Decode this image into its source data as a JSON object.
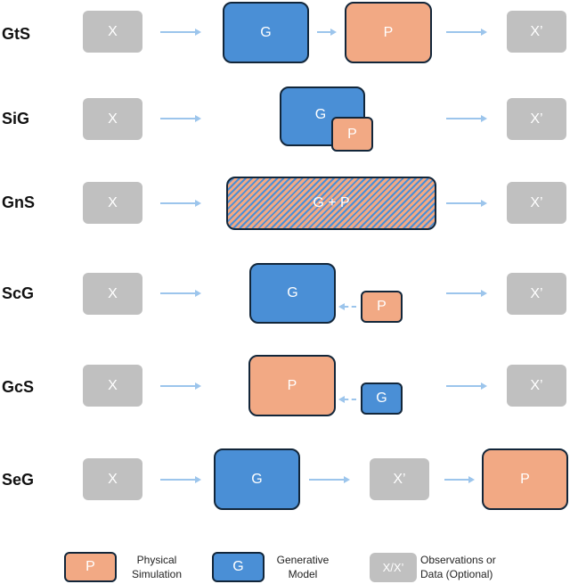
{
  "rows": [
    {
      "label": "GtS",
      "input": "X",
      "output": "X’",
      "g": "G",
      "p": "P"
    },
    {
      "label": "SiG",
      "input": "X",
      "output": "X’",
      "g": "G",
      "p": "P"
    },
    {
      "label": "GnS",
      "input": "X",
      "output": "X’",
      "combined": "G + P"
    },
    {
      "label": "ScG",
      "input": "X",
      "output": "X’",
      "g": "G",
      "p": "P"
    },
    {
      "label": "GcS",
      "input": "X",
      "output": "X’",
      "g": "G",
      "p": "P"
    },
    {
      "label": "SeG",
      "input": "X",
      "intermediate": "X’",
      "g": "G",
      "p": "P"
    }
  ],
  "legend": {
    "physical": {
      "symbol": "P",
      "line1": "Physical",
      "line2": "Simulation"
    },
    "generative": {
      "symbol": "G",
      "line1": "Generative",
      "line2": "Model"
    },
    "data": {
      "symbol": "X/X’",
      "line1": "Observations or",
      "line2": "Data (Optional)"
    }
  },
  "colors": {
    "generative": "#4a8fd6",
    "physical": "#f2a984",
    "data": "#c0c0c0",
    "arrow": "#9cc5ec",
    "border": "#12263a"
  }
}
